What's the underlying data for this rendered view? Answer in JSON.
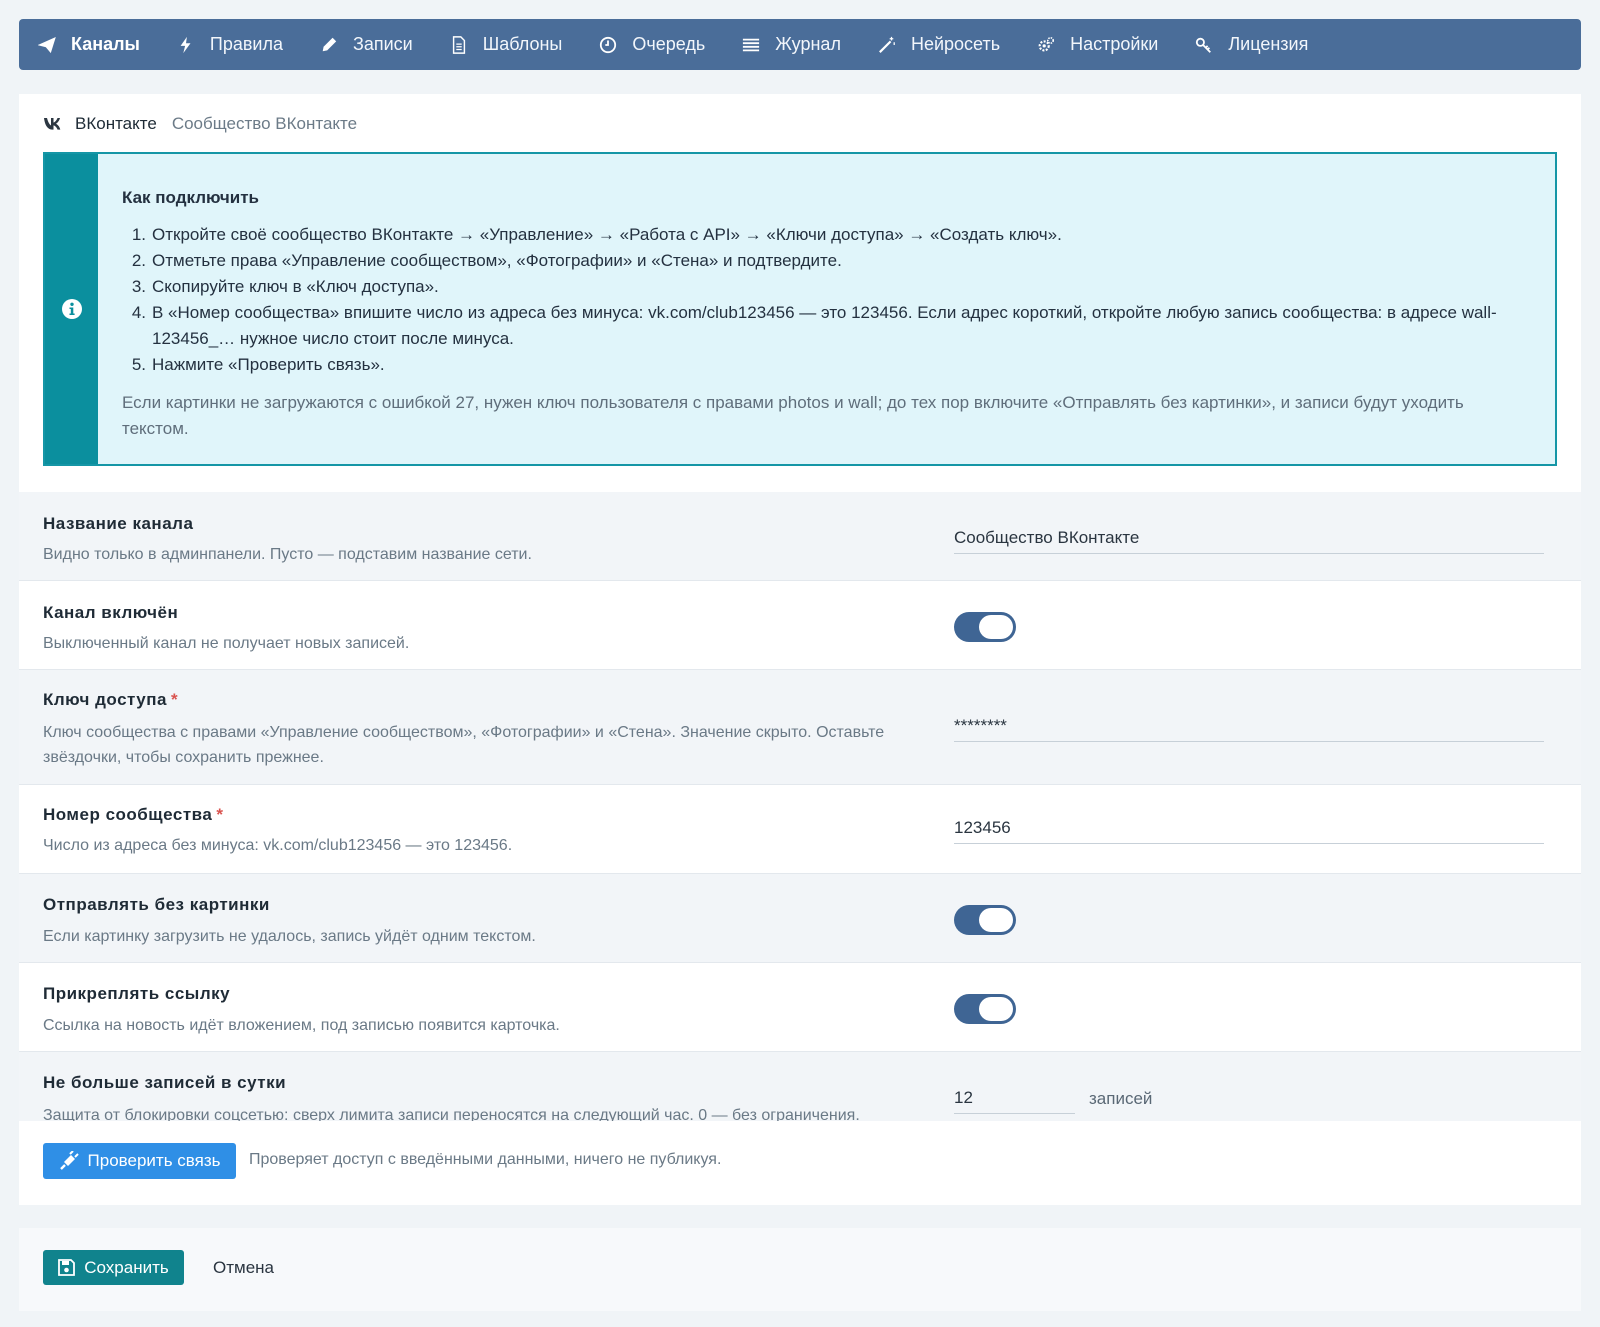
{
  "nav": {
    "items": [
      {
        "label": "Каналы",
        "icon": "paper-plane-icon",
        "active": true
      },
      {
        "label": "Правила",
        "icon": "bolt-icon"
      },
      {
        "label": "Записи",
        "icon": "pencil-icon"
      },
      {
        "label": "Шаблоны",
        "icon": "document-icon"
      },
      {
        "label": "Очередь",
        "icon": "clock-icon"
      },
      {
        "label": "Журнал",
        "icon": "list-icon"
      },
      {
        "label": "Нейросеть",
        "icon": "magic-wand-icon"
      },
      {
        "label": "Настройки",
        "icon": "gears-icon"
      },
      {
        "label": "Лицензия",
        "icon": "key-icon"
      }
    ],
    "colors": {
      "background": "#4a6d99"
    }
  },
  "channel": {
    "network": "ВКонтакте",
    "subtitle": "Сообщество ВКонтакте",
    "info": {
      "title": "Как подключить",
      "steps": [
        {
          "num": "1.",
          "text": "Откройте своё сообщество ВКонтакте → «Управление» → «Работа с API» → «Ключи доступа» → «Создать ключ»."
        },
        {
          "num": "2.",
          "text": "Отметьте права «Управление сообществом», «Фотографии» и «Стена» и подтвердите."
        },
        {
          "num": "3.",
          "text": "Скопируйте ключ в «Ключ доступа»."
        },
        {
          "num": "4.",
          "text": "В «Номер сообщества» впишите число из адреса без минуса: vk.com/club123456 — это 123456. Если адрес короткий, откройте любую запись сообщества: в адресе wall-123456_… нужное число стоит после минуса."
        },
        {
          "num": "5.",
          "text": "Нажмите «Проверить связь»."
        }
      ],
      "note": "Если картинки не загружаются с ошибкой 27, нужен ключ пользователя с правами photos и wall; до тех пор включите «Отправлять без картинки», и записи будут уходить текстом."
    }
  },
  "form": {
    "name": {
      "label": "Название канала",
      "help": "Видно только в админпанели. Пусто — подставим название сети.",
      "value": "Сообщество ВКонтакте"
    },
    "enabled": {
      "label": "Канал включён",
      "help": "Выключенный канал не получает новых записей.",
      "on": true
    },
    "token": {
      "label": "Ключ доступа",
      "required": "*",
      "help": "Ключ сообщества с правами «Управление сообществом», «Фотографии» и «Стена». Значение скрыто. Оставьте звёздочки, чтобы сохранить прежнее.",
      "value": "********"
    },
    "group_id": {
      "label": "Номер сообщества",
      "required": "*",
      "help": "Число из адреса без минуса: vk.com/club123456 — это 123456.",
      "value": "123456"
    },
    "no_image": {
      "label": "Отправлять без картинки",
      "help": "Если картинку загрузить не удалось, запись уйдёт одним текстом.",
      "on": true
    },
    "attach_link": {
      "label": "Прикреплять ссылку",
      "help": "Ссылка на новость идёт вложением, под записью появится карточка.",
      "on": true
    },
    "daily_limit": {
      "label": "Не больше записей в сутки",
      "help": "Защита от блокировки соцсетью: сверх лимита записи переносятся на следующий час. 0 — без ограничения.",
      "value": "12",
      "unit": "записей"
    }
  },
  "check": {
    "button": "Проверить связь",
    "note": "Проверяет доступ с введёнными данными, ничего не публикуя."
  },
  "footer": {
    "save": "Сохранить",
    "cancel": "Отмена"
  },
  "colors": {
    "accent": "#3f6594",
    "info_bar": "#0b8f9e",
    "check_button": "#2f8fe6",
    "save_button": "#10838d",
    "required": "#d9534f"
  }
}
